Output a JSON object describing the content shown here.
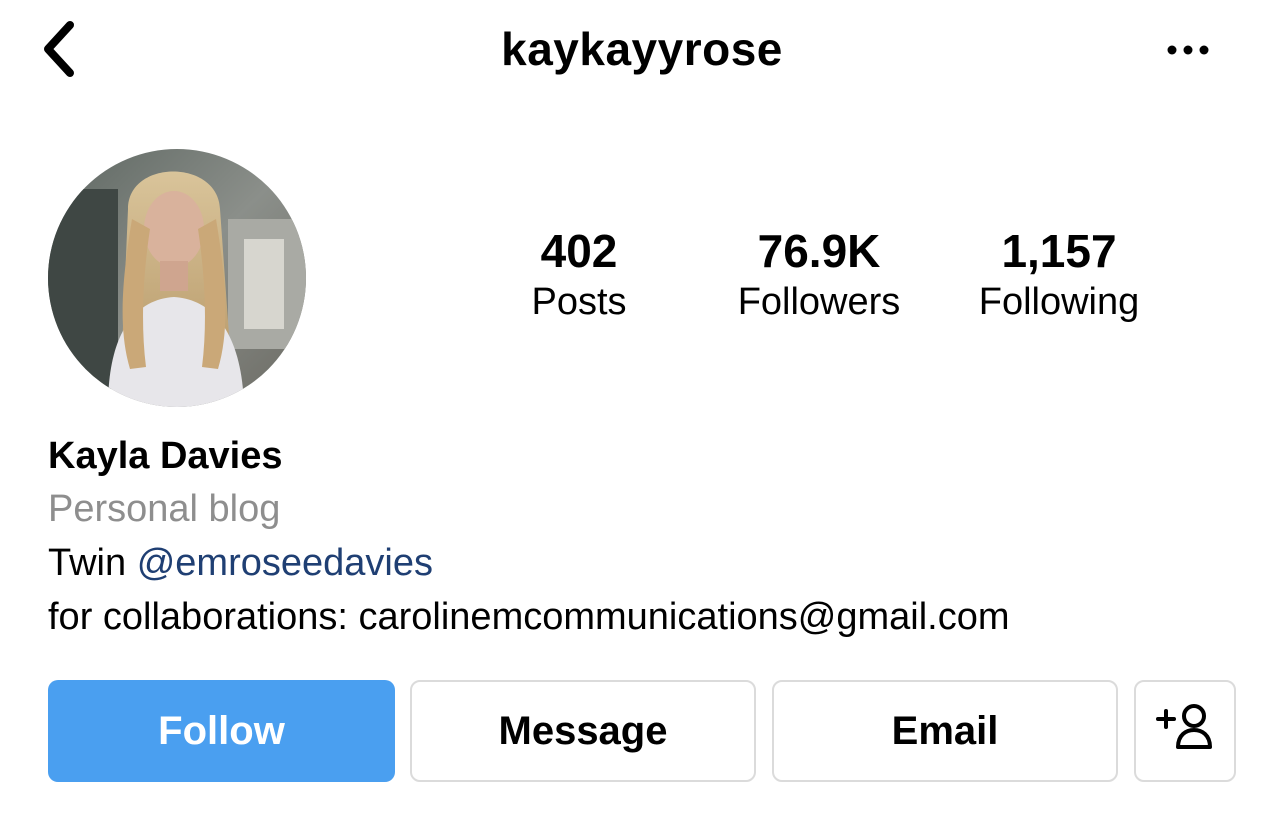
{
  "header": {
    "username": "kaykayyrose",
    "back_icon": "chevron-left-icon",
    "more_icon": "more-horizontal-icon"
  },
  "profile": {
    "avatar_icon": "profile-photo",
    "stats": {
      "posts": {
        "value": "402",
        "label": "Posts"
      },
      "followers": {
        "value": "76.9K",
        "label": "Followers"
      },
      "following": {
        "value": "1,157",
        "label": "Following"
      }
    }
  },
  "bio": {
    "name": "Kayla Davies",
    "category": "Personal blog",
    "line1_prefix": "Twin",
    "mention": "@emroseedavies",
    "line2": "for collaborations: carolinemcommunications@gmail.com"
  },
  "actions": {
    "follow_label": "Follow",
    "message_label": "Message",
    "email_label": "Email",
    "add_user_icon": "add-user-icon"
  },
  "colors": {
    "follow_button": "#4a9ff0",
    "mention_link": "#1f3f73",
    "category_text": "#8e8e8e",
    "button_border": "#dbdbdb"
  }
}
